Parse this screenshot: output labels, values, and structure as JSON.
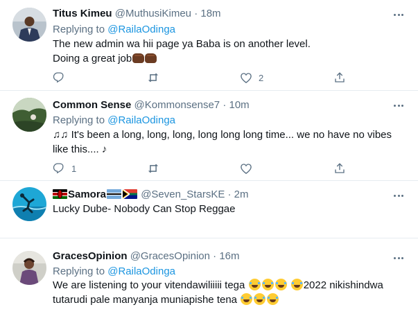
{
  "colors": {
    "link": "#1b95e0",
    "secondary_text": "#5b7083",
    "divider": "#e6ecf0",
    "text": "#0f1419"
  },
  "tweets": [
    {
      "name": "Titus Kimeu",
      "handle": "@MuthusiKimeu",
      "dot": "·",
      "time": "18m",
      "replying_prefix": "Replying to ",
      "replying_to": "@RailaOdinga",
      "lines": [
        "The new admin wa hii page ya Baba is on another level.",
        "Doing a great job"
      ],
      "emoji_after": [
        "oncoming-fist",
        "oncoming-fist"
      ],
      "reply_count": "",
      "retweet_count": "",
      "like_count": "2"
    },
    {
      "name": "Common Sense",
      "handle": "@Kommonsense7",
      "dot": "·",
      "time": "10m",
      "replying_prefix": "Replying to ",
      "replying_to": "@RailaOdinga",
      "lines": [
        "♫♫ It's been a long, long, long, long long long time... we no have no vibes",
        "like this.... ♪"
      ],
      "reply_count": "1",
      "retweet_count": "",
      "like_count": ""
    },
    {
      "name": "Samora",
      "name_flags": [
        "kenya-flag",
        "botswana-flag",
        "south-africa-flag"
      ],
      "handle": "@Seven_StarsKE",
      "dot": "·",
      "time": "2m",
      "lines": [
        "Lucky Dube- Nobody Can Stop Reggae"
      ]
    },
    {
      "name": "GracesOpinion",
      "handle": "@GracesOpinion",
      "dot": "·",
      "time": "16m",
      "replying_prefix": "Replying to ",
      "replying_to": "@RailaOdinga",
      "line1_a": "We are listening to your vitendawiliiiii tega ",
      "line1_b": "2022 nikishindwa",
      "line2": "tutarudi pale manyanja muniapishe tena ",
      "emoji": "face-with-tears-of-joy"
    }
  ]
}
